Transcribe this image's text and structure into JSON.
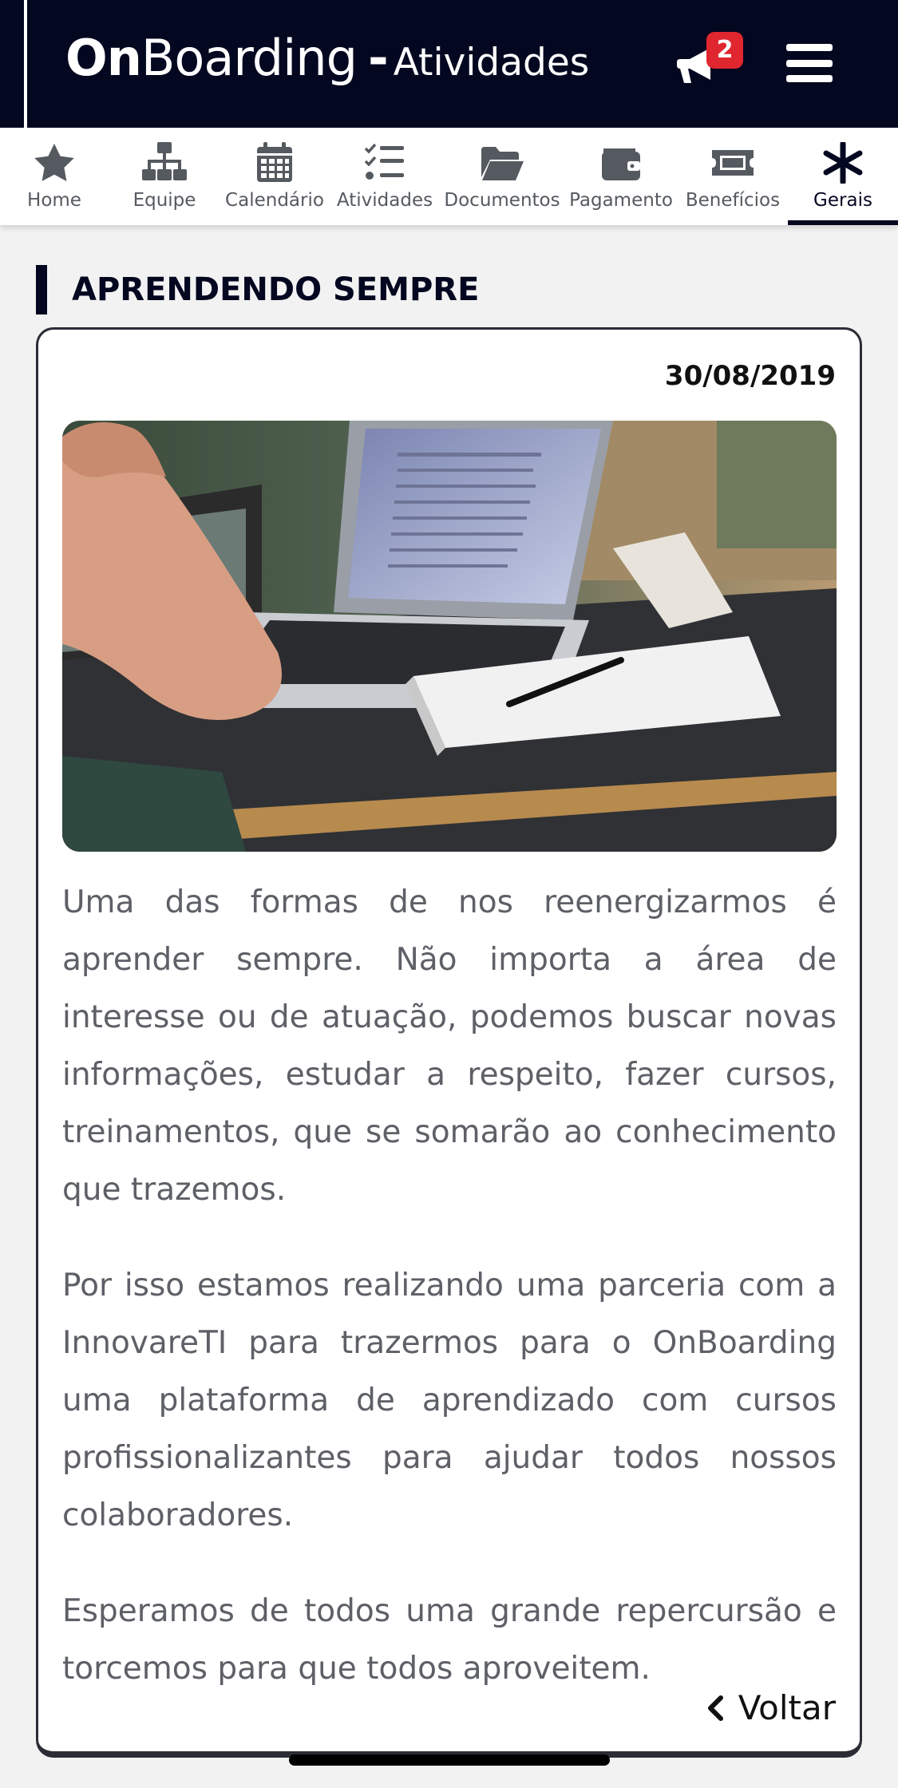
{
  "header": {
    "brand_on": "On",
    "brand_boarding": "Boarding",
    "brand_dash": "-",
    "page_title": "Atividades",
    "notification_count": "2",
    "notification_icon": "megaphone-icon",
    "menu_icon": "hamburger-menu-icon"
  },
  "tabs": [
    {
      "label": "Home",
      "icon": "star-icon"
    },
    {
      "label": "Equipe",
      "icon": "org-chart-icon"
    },
    {
      "label": "Calendário",
      "icon": "calendar-icon"
    },
    {
      "label": "Atividades",
      "icon": "tasks-icon"
    },
    {
      "label": "Documentos",
      "icon": "folder-open-icon"
    },
    {
      "label": "Pagamento",
      "icon": "wallet-icon"
    },
    {
      "label": "Benefícios",
      "icon": "ticket-icon"
    },
    {
      "label": "Gerais",
      "icon": "asterisk-icon",
      "active": true
    }
  ],
  "section": {
    "title": "APRENDENDO SEMPRE"
  },
  "article": {
    "date": "30/08/2019",
    "image_alt": "laptop-on-desk-photo",
    "paragraphs": [
      "Uma das formas de nos reenergizarmos é aprender sempre. Não importa a área de interesse ou de atuação, podemos buscar novas informações, estudar a respeito, fazer cursos, treinamentos, que se somarão ao conhecimento que trazemos.",
      "Por isso estamos realizando uma parceria com a InnovareTI para trazermos para o OnBoarding uma plataforma de aprendizado com cursos profissionalizantes para ajudar todos nossos colaboradores.",
      "Esperamos de todos uma grande repercursão e torcemos para que todos aproveitem."
    ],
    "back_label": "Voltar"
  },
  "colors": {
    "header_bg": "#040720",
    "badge_bg": "#e0262f",
    "body_text": "#5d6066",
    "page_bg": "#f2f2f2"
  }
}
